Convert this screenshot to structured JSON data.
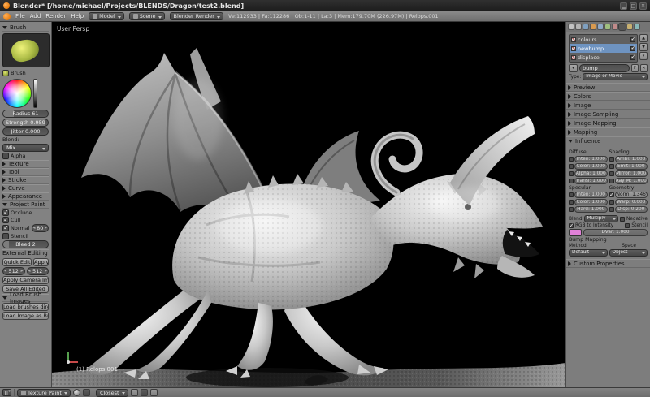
{
  "titlebar": {
    "title": "Blender* [/home/michael/Projects/BLENDS/Dragon/test2.blend]"
  },
  "header": {
    "menus": [
      {
        "label": "File"
      },
      {
        "label": "Add"
      },
      {
        "label": "Render"
      },
      {
        "label": "Help"
      }
    ],
    "layout": "Model",
    "scene": "Scene",
    "engine": "Blender Render",
    "stats": "Ve:112933 | Fa:112286 | Ob:1-11 | La:3 | Mem:179.70M (226.97M) | Relops.001"
  },
  "toolshelf": {
    "brush_panel_title": "Brush",
    "brush_selector_label": "Brush",
    "radius": "Radius 61",
    "strength": "Strength 0.959",
    "jitter": "Jitter 0.000",
    "blend_label": "Blend:",
    "blend_value": "Mix",
    "alpha_label": "Alpha",
    "collapsed_panels": [
      {
        "label": "Texture"
      },
      {
        "label": "Tool"
      },
      {
        "label": "Stroke"
      },
      {
        "label": "Curve"
      },
      {
        "label": "Appearance"
      }
    ],
    "project_paint": {
      "title": "Project Paint",
      "occlude": "Occlude",
      "cull": "Cull",
      "normal_label": "Normal",
      "normal_value": "80",
      "stencil_label": "Stencil",
      "bleed": "Bleed 2"
    },
    "external_editing": {
      "title": "External Editing",
      "quick_edit": "Quick Edit",
      "apply": "Apply",
      "width": "512",
      "height": "512",
      "apply_camera": "Apply Camera Image",
      "save_all": "Save All Edited"
    },
    "load_brush": {
      "title": "Load Brush Images",
      "load_dir": "Load brushes directory",
      "load_image": "Load Image as Brush"
    }
  },
  "viewport": {
    "view_label": "User Persp",
    "object_label": "(1) Relops.001"
  },
  "properties": {
    "texture_slots": [
      {
        "name": "colours"
      },
      {
        "name": "newbump"
      },
      {
        "name": "displace"
      }
    ],
    "datablock": {
      "name": "bump",
      "fake": "F",
      "close": "✕"
    },
    "type_label": "Type:",
    "type_value": "Image or Movie",
    "collapsed_panels": [
      {
        "label": "Preview"
      },
      {
        "label": "Colors"
      },
      {
        "label": "Image"
      },
      {
        "label": "Image Sampling"
      },
      {
        "label": "Image Mapping"
      },
      {
        "label": "Mapping"
      }
    ],
    "influence": {
      "title": "Influence",
      "diffuse_title": "Diffuse",
      "shading_title": "Shading",
      "specular_title": "Specular",
      "geometry_title": "Geometry",
      "diffuse_rows": [
        "Inten: 1.000",
        "Color: 1.000",
        "Alpha: 1.000",
        "Transl: 1.000"
      ],
      "shading_rows": [
        "Ambi: 1.000",
        "Emit: 1.000",
        "Mirror: 1.000",
        "Ray M: 1.000"
      ],
      "specular_rows": [
        "Inten: 1.000",
        "Color: 1.000",
        "Hard: 1.000"
      ],
      "geometry_rows": [
        "Norm: 1.346",
        "Warp: 0.000",
        "Disp: 0.200"
      ],
      "blend_label": "Blend",
      "blend_value": "Multiply",
      "negative": "Negative",
      "rgb_to_intensity": "RGB to Intensity",
      "stencil": "Stencil",
      "dvar": "DVar: 1.000",
      "bump_title": "Bump Mapping",
      "method_label": "Method",
      "method_value": "Default",
      "space_label": "Space",
      "space_value": "Object"
    },
    "custom_properties": "Custom Properties"
  },
  "footer": {
    "mode": "Texture Paint",
    "falloff": "Closest"
  },
  "colors": {
    "selection": "#6e93c0",
    "swatch": "#e081d8",
    "viewport_bg": "#000000"
  }
}
